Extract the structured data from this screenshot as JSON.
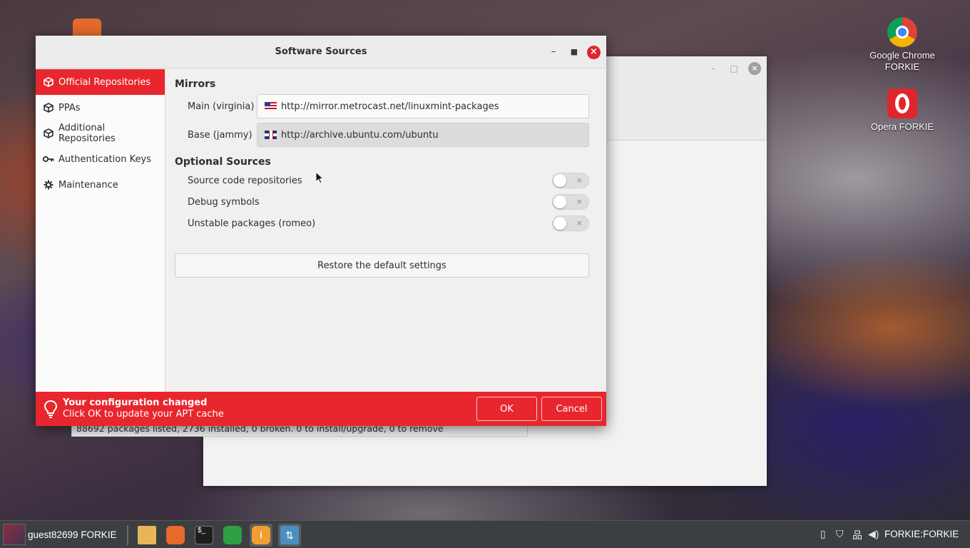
{
  "desktop": {
    "icons": [
      {
        "label_line1": "Google Chrome",
        "label_line2": "FORKIE",
        "icon": "chrome-icon"
      },
      {
        "label_line1": "Opera FORKIE",
        "label_line2": "",
        "icon": "opera-icon"
      }
    ]
  },
  "background_window": {
    "status_text": "88692 packages listed, 2736 installed, 0 broken. 0 to install/upgrade, 0 to remove"
  },
  "dialog": {
    "title": "Software Sources",
    "sidebar": [
      {
        "label": "Official Repositories",
        "icon": "package-icon",
        "active": true
      },
      {
        "label": "PPAs",
        "icon": "package-icon",
        "active": false
      },
      {
        "label": "Additional Repositories",
        "icon": "package-icon",
        "active": false
      },
      {
        "label": "Authentication Keys",
        "icon": "key-icon",
        "active": false
      },
      {
        "label": "Maintenance",
        "icon": "gear-icon",
        "active": false
      }
    ],
    "mirrors": {
      "heading": "Mirrors",
      "main_label": "Main (virginia)",
      "main_url": "http://mirror.metrocast.net/linuxmint-packages",
      "base_label": "Base (jammy)",
      "base_url": "http://archive.ubuntu.com/ubuntu"
    },
    "optional": {
      "heading": "Optional Sources",
      "items": [
        {
          "label": "Source code repositories",
          "enabled": false
        },
        {
          "label": "Debug symbols",
          "enabled": false
        },
        {
          "label": "Unstable packages (romeo)",
          "enabled": false
        }
      ]
    },
    "restore_label": "Restore the default settings",
    "infobar": {
      "title": "Your configuration changed",
      "message": "Click OK to update your APT cache",
      "ok_label": "OK",
      "cancel_label": "Cancel"
    }
  },
  "taskbar": {
    "user": "guest82699 FORKIE",
    "clock": "FORKIE:FORKIE",
    "colors": {
      "accent": "#e8262d",
      "panel": "#3c3f41"
    }
  }
}
